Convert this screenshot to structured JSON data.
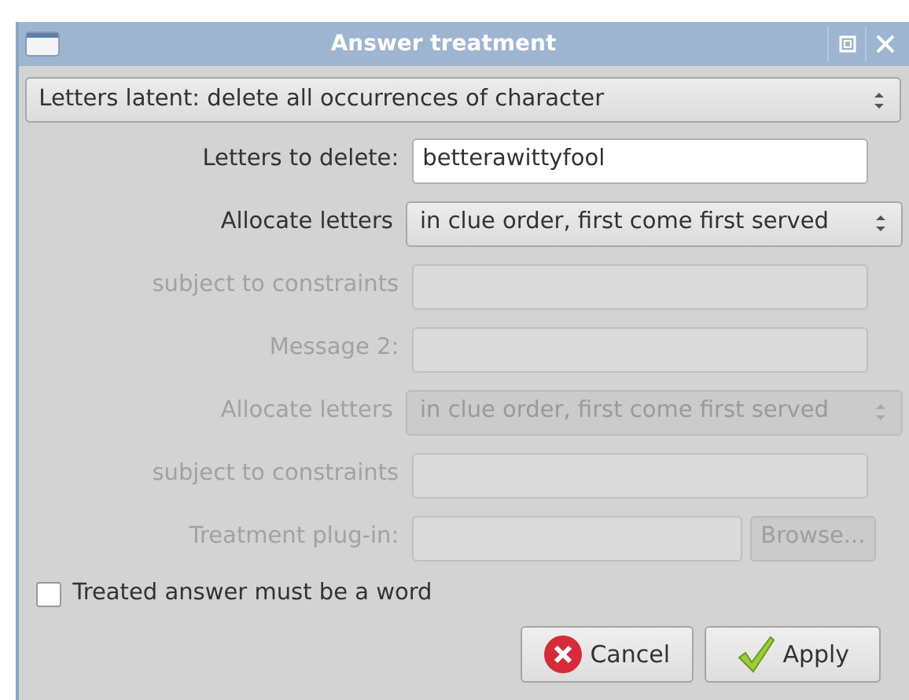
{
  "window": {
    "title": "Answer treatment"
  },
  "treatment": {
    "value": "Letters latent: delete all occurrences of character"
  },
  "rows": [
    {
      "kind": "text",
      "label": "Letters to delete:",
      "value": "betterawittyfool",
      "disabled": false
    },
    {
      "kind": "combo",
      "label": "Allocate letters",
      "value": "in clue order, first come first served",
      "disabled": false
    },
    {
      "kind": "text",
      "label": "subject to constraints",
      "disabled": true
    },
    {
      "kind": "text",
      "label": "Message 2:",
      "disabled": true
    },
    {
      "kind": "combo",
      "label": "Allocate letters",
      "value": "in clue order, first come first served",
      "disabled": true
    },
    {
      "kind": "text",
      "label": "subject to constraints",
      "disabled": true
    },
    {
      "kind": "file",
      "label": "Treatment plug-in:",
      "button": "Browse...",
      "disabled": true
    }
  ],
  "checkbox": {
    "label": "Treated answer must be a word",
    "checked": false
  },
  "buttons": [
    {
      "kind": "cancel",
      "label": "Cancel"
    },
    {
      "kind": "apply",
      "label": "Apply"
    }
  ]
}
